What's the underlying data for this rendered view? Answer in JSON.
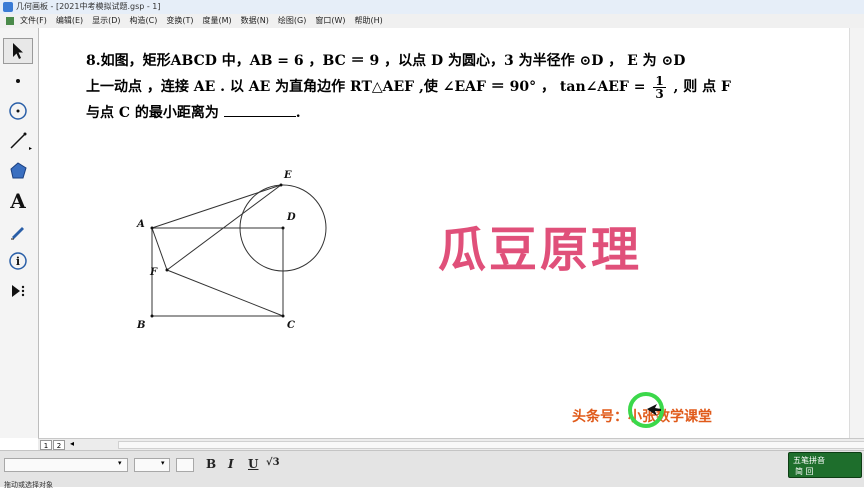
{
  "window": {
    "title": "几何画板 - [2021中考模拟试题.gsp - 1]"
  },
  "menu": {
    "items": [
      "文件(F)",
      "编辑(E)",
      "显示(D)",
      "构造(C)",
      "变换(T)",
      "度量(M)",
      "数据(N)",
      "绘图(G)",
      "窗口(W)",
      "帮助(H)"
    ]
  },
  "toolbar": {
    "tools": [
      "selection-arrow",
      "point",
      "compass",
      "straightedge",
      "polygon",
      "text",
      "marker",
      "information",
      "custom-tools"
    ],
    "text_tool_label": "A"
  },
  "problem": {
    "line1": "8.如图，矩形ABCD 中，AB = 6 ，BC ＝ 9 ，以点 D 为圆心，3 为半径作 ⊙D ， E 为 ⊙D",
    "line2_a": "上一动点 ，连接 AE . 以 AE 为直角边作 RT△AEF ,使 ∠EAF ＝ 90° ，  tan∠AEF =",
    "frac_num": "1",
    "frac_den": "3",
    "line2_b": ", 则 点 F",
    "line3": "与点 C 的最小距离为",
    "line3_end": "."
  },
  "figure": {
    "labels": {
      "A": "A",
      "B": "B",
      "C": "C",
      "D": "D",
      "E": "E",
      "F": "F"
    }
  },
  "watermark": "瓜豆原理",
  "credit": "头条号：小张数学课堂",
  "page_tabs": [
    "1",
    "2"
  ],
  "format_bar": {
    "bold": "B",
    "italic": "I",
    "underline": "U",
    "math": "√3"
  },
  "ime": {
    "name": "五笔拼音",
    "row2": "简 回"
  },
  "status": {
    "text": "拖动或选择对象"
  },
  "colors": {
    "watermark": "#e0507a",
    "credit": "#e05a1a",
    "cursor_ring": "#3bd84a"
  }
}
